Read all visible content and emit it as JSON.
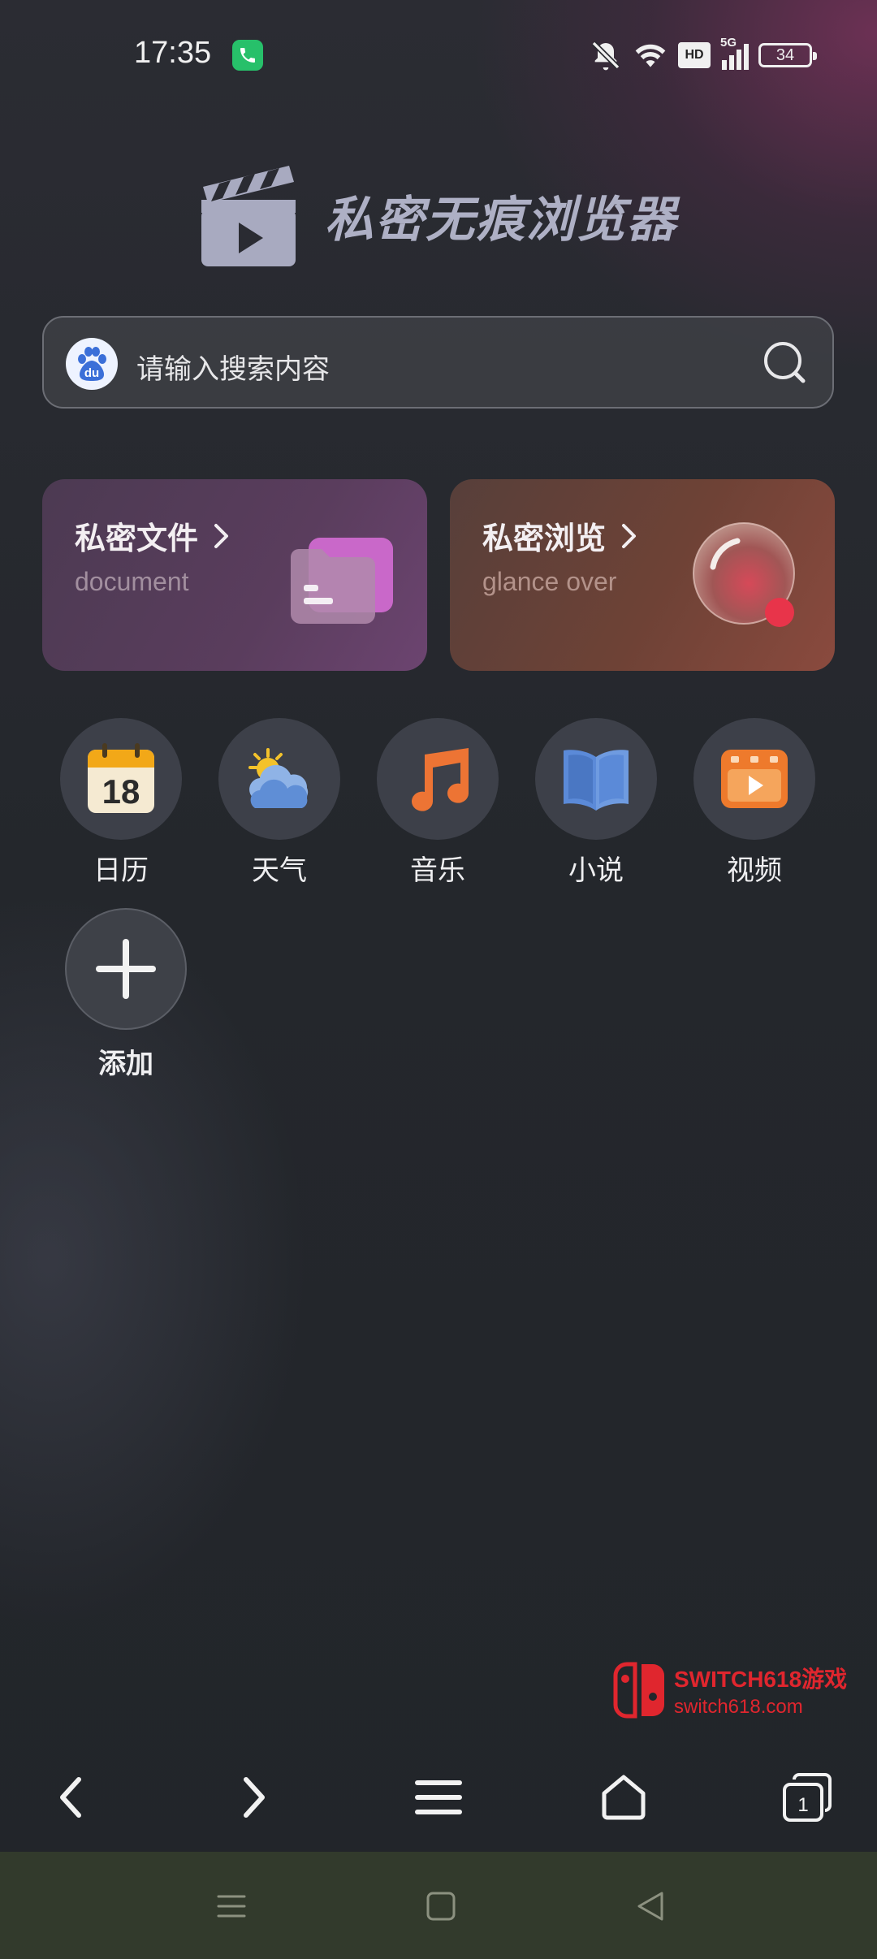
{
  "status_bar": {
    "time": "17:35",
    "call_icon": "phone-icon",
    "icons": [
      "mute-icon",
      "wifi-icon",
      "hd-icon",
      "5g-signal-icon",
      "battery-icon"
    ],
    "hd_label": "HD",
    "network_label": "5G",
    "battery_level": "34"
  },
  "header": {
    "logo_icon": "clapperboard-play-icon",
    "app_title": "私密无痕浏览器"
  },
  "search": {
    "engine_icon": "baidu-icon",
    "engine_badge": "du",
    "placeholder": "请输入搜索内容",
    "search_icon": "search-icon"
  },
  "cards": [
    {
      "title": "私密文件",
      "subtitle": "document",
      "icon": "folder-icon",
      "arrow": ">"
    },
    {
      "title": "私密浏览",
      "subtitle": "glance over",
      "icon": "glass-orb-icon",
      "arrow": ">"
    }
  ],
  "apps": [
    {
      "label": "日历",
      "icon": "calendar-icon",
      "icon_text": "18"
    },
    {
      "label": "天气",
      "icon": "weather-icon"
    },
    {
      "label": "音乐",
      "icon": "music-note-icon"
    },
    {
      "label": "小说",
      "icon": "book-icon"
    },
    {
      "label": "视频",
      "icon": "video-icon"
    }
  ],
  "add_app": {
    "label": "添加",
    "icon": "plus-icon"
  },
  "watermark": {
    "brand": "SWITCH618游戏",
    "url": "switch618.com"
  },
  "toolbar": {
    "items": [
      "back-icon",
      "forward-icon",
      "menu-icon",
      "home-icon",
      "tabs-icon"
    ],
    "tab_count": "1"
  },
  "system_nav": {
    "items": [
      "recents-icon",
      "home-square-icon",
      "back-triangle-icon"
    ]
  },
  "colors": {
    "background": "#23262b",
    "card_files": "#5a3d5d",
    "card_browse": "#7a4438",
    "accent_red": "#e0262e"
  }
}
